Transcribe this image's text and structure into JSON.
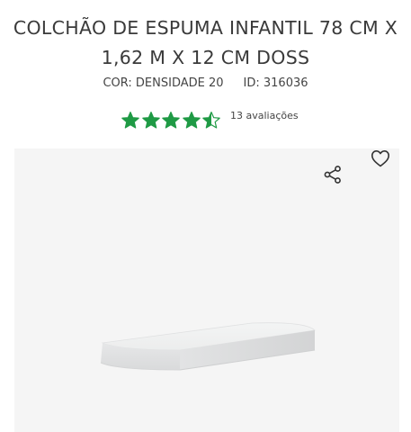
{
  "product": {
    "title": "COLCHÃO DE ESPUMA INFANTIL 78 CM X 1,62 M X 12 CM DOSS",
    "color_label": "COR: DENSIDADE 20",
    "id_label": "ID: 316036"
  },
  "rating": {
    "stars": 4.5,
    "max_stars": 5,
    "count_label": "13 avaliações",
    "star_color": "#1f9a45"
  },
  "gallery": {
    "background": "#f5f5f5",
    "icons": [
      "share-icon",
      "heart-icon"
    ]
  }
}
